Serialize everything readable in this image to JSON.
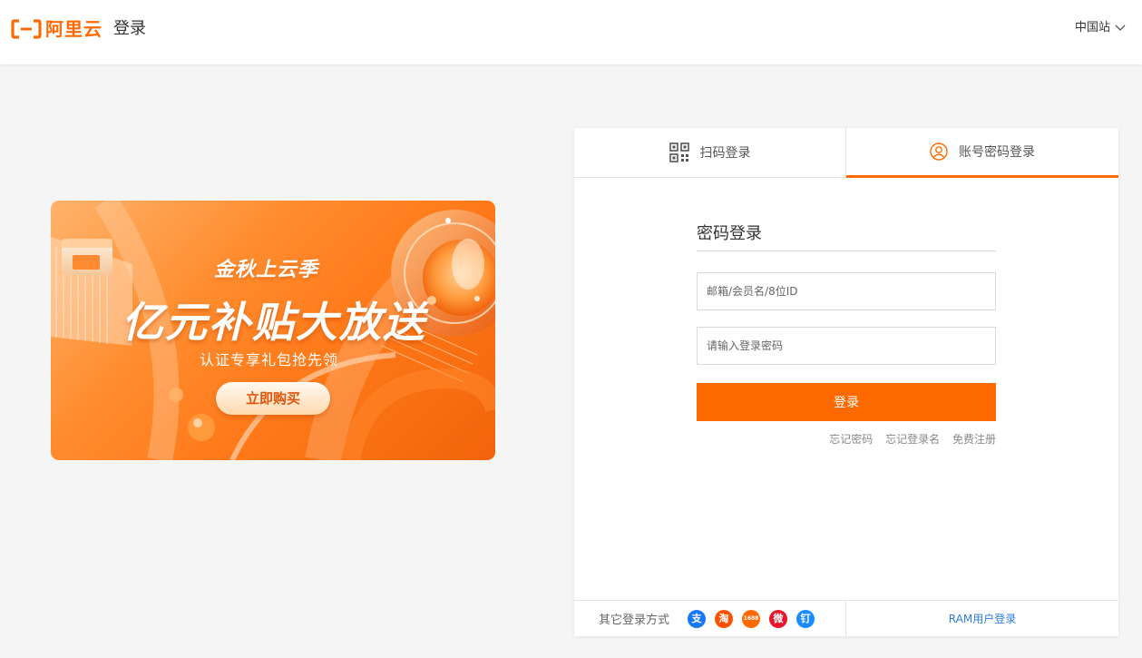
{
  "header": {
    "logo_text": "阿里云",
    "title": "登录",
    "site_selector": "中国站"
  },
  "banner": {
    "subtitle": "金秋上云季",
    "headline": "亿元补贴大放送",
    "description": "认证专享礼包抢先领",
    "cta": "立即购买"
  },
  "tabs": [
    {
      "label": "扫码登录",
      "icon": "qrcode-icon"
    },
    {
      "label": "账号密码登录",
      "icon": "user-circle-icon",
      "active": true
    }
  ],
  "form": {
    "title": "密码登录",
    "username_placeholder": "邮箱/会员名/8位ID",
    "password_placeholder": "请输入登录密码",
    "submit": "登录",
    "links": [
      "忘记密码",
      "忘记登录名",
      "免费注册"
    ]
  },
  "footer": {
    "other_label": "其它登录方式",
    "social": [
      {
        "name": "alipay-icon",
        "glyph": "支",
        "color": "#1677ff"
      },
      {
        "name": "taobao-icon",
        "glyph": "淘",
        "color": "#ff5000"
      },
      {
        "name": "1688-icon",
        "glyph": "1688",
        "color": "#ff6a00"
      },
      {
        "name": "weibo-icon",
        "glyph": "微",
        "color": "#e6162d"
      },
      {
        "name": "dingtalk-icon",
        "glyph": "钉",
        "color": "#1a8cff"
      }
    ],
    "ram_login": "RAM用户登录"
  },
  "colors": {
    "brand": "#ff6a00",
    "link": "#2e7cdb",
    "background": "#f5f5f5"
  }
}
